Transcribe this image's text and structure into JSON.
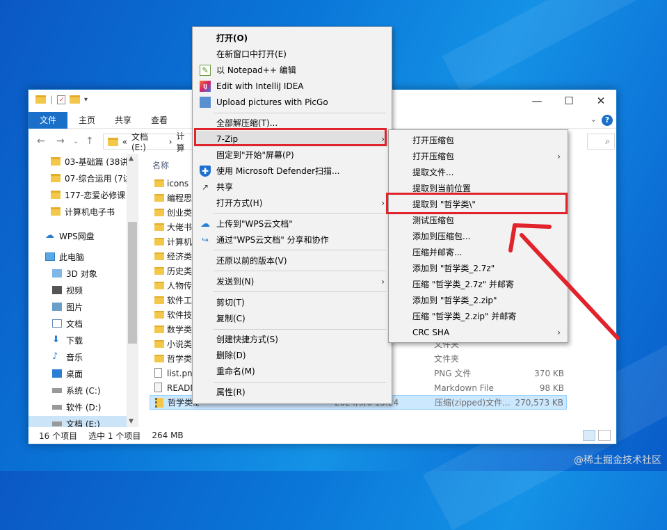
{
  "explorer": {
    "ribbon_tabs": [
      "文件",
      "主页",
      "共享",
      "查看"
    ],
    "address": [
      "«",
      "文档 (E:)",
      "›",
      "计算"
    ],
    "column_name": "名称",
    "nav_items": [
      {
        "label": "03-基础篇 (38讲",
        "icon": "folder-icon"
      },
      {
        "label": "07-综合运用 (7讲",
        "icon": "folder-icon"
      },
      {
        "label": "177-恋爱必修课",
        "icon": "folder-icon"
      },
      {
        "label": "计算机电子书",
        "icon": "folder-icon"
      },
      {
        "label": "WPS网盘",
        "icon": "cloud-icon"
      },
      {
        "label": "此电脑",
        "icon": "computer-icon"
      },
      {
        "label": "3D 对象",
        "icon": "cube-icon"
      },
      {
        "label": "视频",
        "icon": "video-icon"
      },
      {
        "label": "图片",
        "icon": "picture-icon"
      },
      {
        "label": "文档",
        "icon": "document-icon"
      },
      {
        "label": "下载",
        "icon": "download-icon"
      },
      {
        "label": "音乐",
        "icon": "music-icon"
      },
      {
        "label": "桌面",
        "icon": "desktop-icon"
      },
      {
        "label": "系统 (C:)",
        "icon": "drive-icon"
      },
      {
        "label": "软件 (D:)",
        "icon": "drive-icon"
      },
      {
        "label": "文档 (E:)",
        "icon": "drive-icon"
      }
    ],
    "files": [
      {
        "name": "icons",
        "date": "",
        "type": "",
        "size": ""
      },
      {
        "name": "编程思想",
        "date": "",
        "type": "",
        "size": ""
      },
      {
        "name": "创业类",
        "date": "",
        "type": "",
        "size": ""
      },
      {
        "name": "大佬书",
        "date": "",
        "type": "",
        "size": ""
      },
      {
        "name": "计算机",
        "date": "",
        "type": "",
        "size": ""
      },
      {
        "name": "经济类",
        "date": "",
        "type": "",
        "size": ""
      },
      {
        "name": "历史类",
        "date": "",
        "type": "",
        "size": ""
      },
      {
        "name": "人物传",
        "date": "",
        "type": "",
        "size": ""
      },
      {
        "name": "软件工",
        "date": "",
        "type": "",
        "size": ""
      },
      {
        "name": "软件技",
        "date": "",
        "type": "",
        "size": ""
      },
      {
        "name": "数学类",
        "date": "",
        "type": "",
        "size": ""
      },
      {
        "name": "小说类",
        "date": "",
        "type": "文件夹",
        "size": ""
      },
      {
        "name": "哲学类",
        "date": "2",
        "type": "文件夹",
        "size": ""
      },
      {
        "name": "list.png",
        "date": "2",
        "type": "PNG 文件",
        "size": "370 KB"
      },
      {
        "name": "READM",
        "date": "2",
        "type": "Markdown File",
        "size": "98 KB"
      },
      {
        "name": "哲学类.zip",
        "date": "2024/9/6 15:24",
        "type": "压缩(zipped)文件...",
        "size": "270,573 KB"
      }
    ],
    "status": {
      "count": "16 个项目",
      "selected": "选中 1 个项目",
      "size": "264 MB"
    }
  },
  "context_menu": {
    "items": [
      "打开(O)",
      "在新窗口中打开(E)",
      "以 Notepad++ 编辑",
      "Edit with IntelliJ IDEA",
      "Upload pictures with PicGo",
      "全部解压缩(T)...",
      "7-Zip",
      "固定到\"开始\"屏幕(P)",
      "使用 Microsoft Defender扫描...",
      "共享",
      "打开方式(H)",
      "上传到\"WPS云文档\"",
      "通过\"WPS云文档\" 分享和协作",
      "还原以前的版本(V)",
      "发送到(N)",
      "剪切(T)",
      "复制(C)",
      "创建快捷方式(S)",
      "删除(D)",
      "重命名(M)",
      "属性(R)"
    ]
  },
  "submenu_7zip": {
    "items": [
      "打开压缩包",
      "打开压缩包",
      "提取文件...",
      "提取到当前位置",
      "提取到 \"哲学类\\\"",
      "测试压缩包",
      "添加到压缩包...",
      "压缩并邮寄...",
      "添加到 \"哲学类_2.7z\"",
      "压缩 \"哲学类_2.7z\" 并邮寄",
      "添加到 \"哲学类_2.zip\"",
      "压缩 \"哲学类_2.zip\" 并邮寄",
      "CRC SHA"
    ]
  },
  "watermark": "@稀土掘金技术社区",
  "colors": {
    "highlight": "#e1232b",
    "accent": "#1a6fc9"
  }
}
